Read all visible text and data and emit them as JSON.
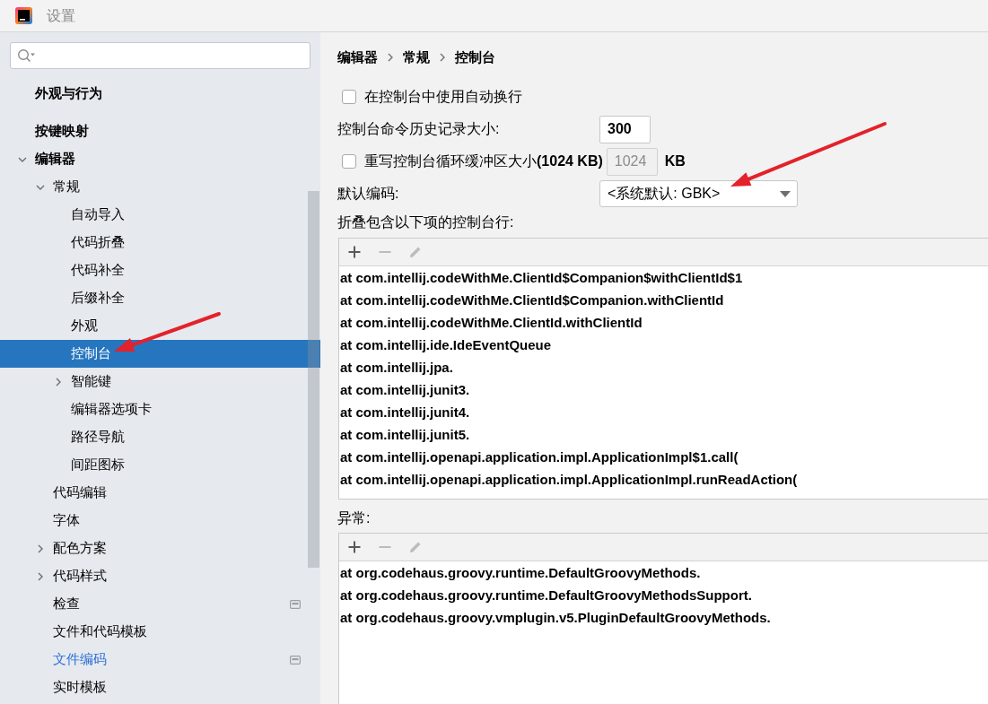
{
  "window": {
    "title": "设置"
  },
  "sidebar": {
    "items": [
      {
        "label": "外观与行为",
        "selected": false,
        "modified": false,
        "project_level": false
      },
      {
        "label": "按键映射",
        "selected": false,
        "modified": false,
        "project_level": false
      },
      {
        "label": "编辑器",
        "selected": false,
        "modified": false,
        "project_level": false,
        "expanded": true,
        "children": [
          {
            "label": "常规",
            "selected": false,
            "modified": false,
            "project_level": false,
            "expanded": true,
            "children": [
              {
                "label": "自动导入",
                "selected": false,
                "modified": false,
                "project_level": false
              },
              {
                "label": "代码折叠",
                "selected": false,
                "modified": false,
                "project_level": false
              },
              {
                "label": "代码补全",
                "selected": false,
                "modified": false,
                "project_level": false
              },
              {
                "label": "后缀补全",
                "selected": false,
                "modified": false,
                "project_level": false
              },
              {
                "label": "外观",
                "selected": false,
                "modified": false,
                "project_level": false
              },
              {
                "label": "控制台",
                "selected": true,
                "modified": false,
                "project_level": false
              },
              {
                "label": "智能键",
                "selected": false,
                "modified": false,
                "project_level": false,
                "expanded": false
              },
              {
                "label": "编辑器选项卡",
                "selected": false,
                "modified": false,
                "project_level": false
              },
              {
                "label": "路径导航",
                "selected": false,
                "modified": false,
                "project_level": false
              },
              {
                "label": "间距图标",
                "selected": false,
                "modified": false,
                "project_level": false
              }
            ]
          },
          {
            "label": "代码编辑",
            "selected": false,
            "modified": false,
            "project_level": false
          },
          {
            "label": "字体",
            "selected": false,
            "modified": false,
            "project_level": false
          },
          {
            "label": "配色方案",
            "selected": false,
            "modified": false,
            "project_level": false,
            "expanded": false
          },
          {
            "label": "代码样式",
            "selected": false,
            "modified": false,
            "project_level": false,
            "expanded": false
          },
          {
            "label": "检查",
            "selected": false,
            "modified": false,
            "project_level": true
          },
          {
            "label": "文件和代码模板",
            "selected": false,
            "modified": false,
            "project_level": false
          },
          {
            "label": "文件编码",
            "selected": false,
            "modified": true,
            "project_level": true
          },
          {
            "label": "实时模板",
            "selected": false,
            "modified": false,
            "project_level": false
          }
        ]
      }
    ]
  },
  "breadcrumb": [
    "编辑器",
    "常规",
    "控制台"
  ],
  "settings": [
    {
      "kind": "checkbox",
      "label": "在控制台中使用自动换行",
      "checked": false
    },
    {
      "kind": "number",
      "label": "控制台命令历史记录大小:",
      "value": "300",
      "disabled": false
    },
    {
      "kind": "checkbox_number",
      "label": "重写控制台循环缓冲区大小**(1024 KB)**",
      "checked": false,
      "value": "1024",
      "disabled": true,
      "unit": "KB"
    },
    {
      "kind": "select",
      "label": "默认编码:",
      "value": "<系统默认: GBK>"
    }
  ],
  "fold_lines": {
    "label": "折叠包含以下项的控制台行:",
    "toolbar": [
      {
        "kind": "add",
        "disabled": false
      },
      {
        "kind": "remove",
        "disabled": true
      },
      {
        "kind": "edit",
        "disabled": true
      }
    ],
    "rows": [
      "at com.intellij.codeWithMe.ClientId$Companion$withClientId$1",
      "at com.intellij.codeWithMe.ClientId$Companion.withClientId",
      "at com.intellij.codeWithMe.ClientId.withClientId",
      "at com.intellij.ide.IdeEventQueue",
      "at com.intellij.jpa.",
      "at com.intellij.junit3.",
      "at com.intellij.junit4.",
      "at com.intellij.junit5.",
      "at com.intellij.openapi.application.impl.ApplicationImpl$1.call(",
      "at com.intellij.openapi.application.impl.ApplicationImpl.runReadAction("
    ]
  },
  "exceptions": {
    "label": "异常:",
    "toolbar": [
      {
        "kind": "add",
        "disabled": false
      },
      {
        "kind": "remove",
        "disabled": true
      },
      {
        "kind": "edit",
        "disabled": true
      }
    ],
    "rows": [
      "at org.codehaus.groovy.runtime.DefaultGroovyMethods.",
      "at org.codehaus.groovy.runtime.DefaultGroovyMethodsSupport.",
      "at org.codehaus.groovy.vmplugin.v5.PluginDefaultGroovyMethods."
    ]
  }
}
